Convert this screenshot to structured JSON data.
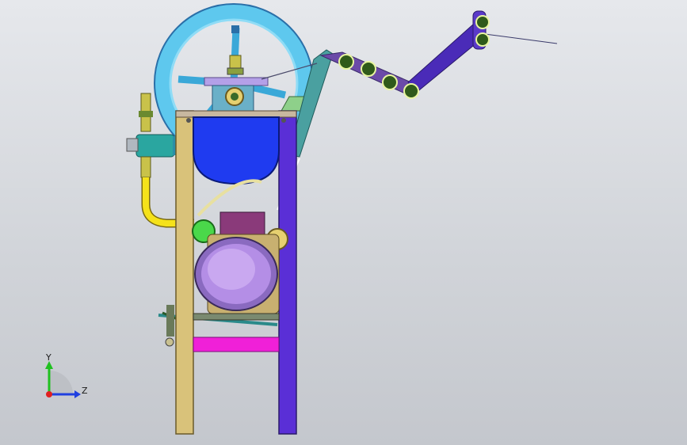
{
  "triad": {
    "y_label": "Y",
    "z_label": "Z"
  },
  "colors": {
    "background_top": "#e6e8ec",
    "background_bottom": "#c4c7cd",
    "wheel": "#4fc3e8",
    "frame_left_leg": "#d9c27a",
    "frame_right_leg": "#5a2fd6",
    "hopper": "#1f3bf0",
    "motor_body": "#b48ee6",
    "cross_beam": "#f020d8",
    "hose": "#f5e21a",
    "pump": "#2aa6a0",
    "arm": "#4a2bb8",
    "rollers": "#2f5a1a"
  }
}
